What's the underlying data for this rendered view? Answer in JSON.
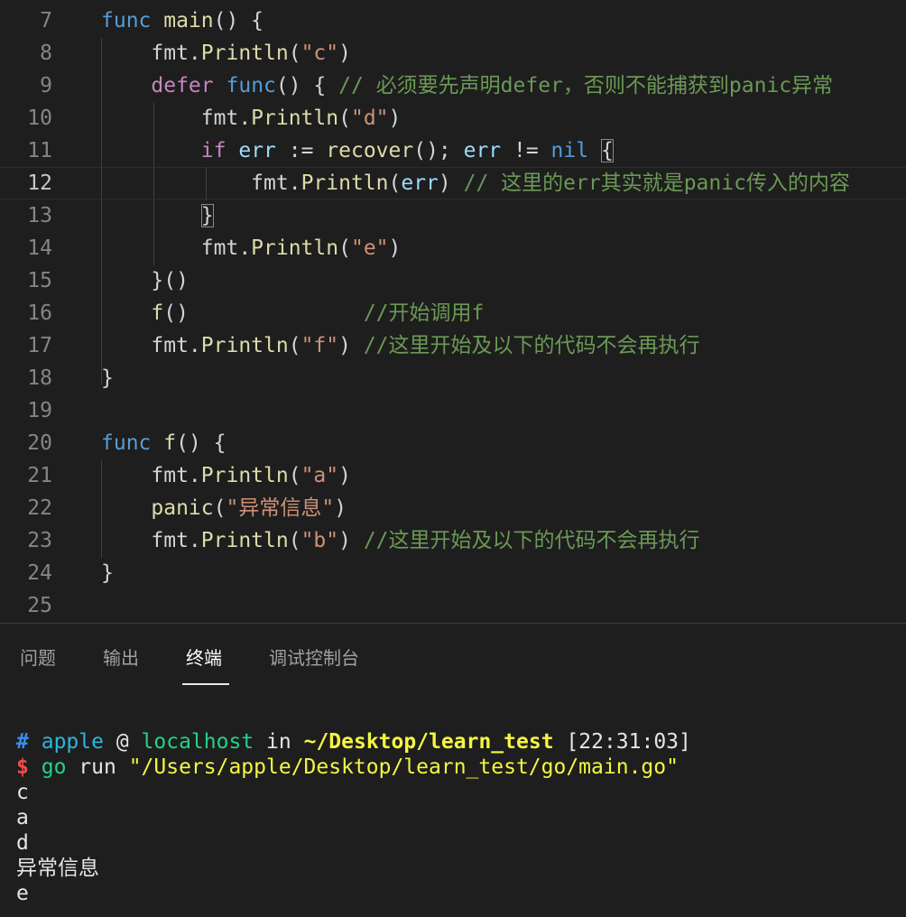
{
  "editor": {
    "lines": [
      {
        "n": "7",
        "tokens": [
          {
            "c": "kw",
            "t": "func"
          },
          {
            "c": "pl",
            "t": " "
          },
          {
            "c": "fn",
            "t": "main"
          },
          {
            "c": "pl",
            "t": "() {"
          }
        ]
      },
      {
        "n": "8",
        "tokens": [
          {
            "c": "pl",
            "t": "    fmt."
          },
          {
            "c": "fn",
            "t": "Println"
          },
          {
            "c": "pl",
            "t": "("
          },
          {
            "c": "str",
            "t": "\"c\""
          },
          {
            "c": "pl",
            "t": ")"
          }
        ]
      },
      {
        "n": "9",
        "tokens": [
          {
            "c": "pl",
            "t": "    "
          },
          {
            "c": "ctl",
            "t": "defer"
          },
          {
            "c": "pl",
            "t": " "
          },
          {
            "c": "kw",
            "t": "func"
          },
          {
            "c": "pl",
            "t": "() { "
          },
          {
            "c": "cm",
            "t": "// 必须要先声明defer，否则不能捕获到panic异常"
          }
        ]
      },
      {
        "n": "10",
        "tokens": [
          {
            "c": "pl",
            "t": "        fmt."
          },
          {
            "c": "fn",
            "t": "Println"
          },
          {
            "c": "pl",
            "t": "("
          },
          {
            "c": "str",
            "t": "\"d\""
          },
          {
            "c": "pl",
            "t": ")"
          }
        ]
      },
      {
        "n": "11",
        "tokens": [
          {
            "c": "pl",
            "t": "        "
          },
          {
            "c": "ctl",
            "t": "if"
          },
          {
            "c": "pl",
            "t": " "
          },
          {
            "c": "var",
            "t": "err"
          },
          {
            "c": "pl",
            "t": " := "
          },
          {
            "c": "fn",
            "t": "recover"
          },
          {
            "c": "pl",
            "t": "(); "
          },
          {
            "c": "var",
            "t": "err"
          },
          {
            "c": "pl",
            "t": " != "
          },
          {
            "c": "kw",
            "t": "nil"
          },
          {
            "c": "pl",
            "t": " "
          },
          {
            "c": "pl box",
            "t": "{"
          }
        ]
      },
      {
        "n": "12",
        "tokens": [
          {
            "c": "pl",
            "t": "            fmt."
          },
          {
            "c": "fn",
            "t": "Println"
          },
          {
            "c": "pl",
            "t": "("
          },
          {
            "c": "var",
            "t": "err"
          },
          {
            "c": "pl",
            "t": ") "
          },
          {
            "c": "cm",
            "t": "// 这里的err其实就是panic传入的内容"
          }
        ]
      },
      {
        "n": "13",
        "tokens": [
          {
            "c": "pl",
            "t": "        "
          },
          {
            "c": "pl box",
            "t": "}"
          }
        ]
      },
      {
        "n": "14",
        "tokens": [
          {
            "c": "pl",
            "t": "        fmt."
          },
          {
            "c": "fn",
            "t": "Println"
          },
          {
            "c": "pl",
            "t": "("
          },
          {
            "c": "str",
            "t": "\"e\""
          },
          {
            "c": "pl",
            "t": ")"
          }
        ]
      },
      {
        "n": "15",
        "tokens": [
          {
            "c": "pl",
            "t": "    }()"
          }
        ]
      },
      {
        "n": "16",
        "tokens": [
          {
            "c": "pl",
            "t": "    "
          },
          {
            "c": "fn",
            "t": "f"
          },
          {
            "c": "pl",
            "t": "()              "
          },
          {
            "c": "cm",
            "t": "//开始调用f"
          }
        ]
      },
      {
        "n": "17",
        "tokens": [
          {
            "c": "pl",
            "t": "    fmt."
          },
          {
            "c": "fn",
            "t": "Println"
          },
          {
            "c": "pl",
            "t": "("
          },
          {
            "c": "str",
            "t": "\"f\""
          },
          {
            "c": "pl",
            "t": ") "
          },
          {
            "c": "cm",
            "t": "//这里开始及以下的代码不会再执行"
          }
        ]
      },
      {
        "n": "18",
        "tokens": [
          {
            "c": "pl",
            "t": "}"
          }
        ]
      },
      {
        "n": "19",
        "tokens": []
      },
      {
        "n": "20",
        "tokens": [
          {
            "c": "kw",
            "t": "func"
          },
          {
            "c": "pl",
            "t": " "
          },
          {
            "c": "fn",
            "t": "f"
          },
          {
            "c": "pl",
            "t": "() {"
          }
        ]
      },
      {
        "n": "21",
        "tokens": [
          {
            "c": "pl",
            "t": "    fmt."
          },
          {
            "c": "fn",
            "t": "Println"
          },
          {
            "c": "pl",
            "t": "("
          },
          {
            "c": "str",
            "t": "\"a\""
          },
          {
            "c": "pl",
            "t": ")"
          }
        ]
      },
      {
        "n": "22",
        "tokens": [
          {
            "c": "pl",
            "t": "    "
          },
          {
            "c": "fn",
            "t": "panic"
          },
          {
            "c": "pl",
            "t": "("
          },
          {
            "c": "str",
            "t": "\"异常信息\""
          },
          {
            "c": "pl",
            "t": ")"
          }
        ]
      },
      {
        "n": "23",
        "tokens": [
          {
            "c": "pl",
            "t": "    fmt."
          },
          {
            "c": "fn",
            "t": "Println"
          },
          {
            "c": "pl",
            "t": "("
          },
          {
            "c": "str",
            "t": "\"b\""
          },
          {
            "c": "pl",
            "t": ") "
          },
          {
            "c": "cm",
            "t": "//这里开始及以下的代码不会再执行"
          }
        ]
      },
      {
        "n": "24",
        "tokens": [
          {
            "c": "pl",
            "t": "}"
          }
        ]
      },
      {
        "n": "25",
        "tokens": []
      }
    ],
    "current_line": "12"
  },
  "panel": {
    "tabs": [
      {
        "label": "问题"
      },
      {
        "label": "输出"
      },
      {
        "label": "终端",
        "active": true
      },
      {
        "label": "调试控制台"
      }
    ]
  },
  "terminal": {
    "prompt": {
      "hash": "#",
      "user": "apple",
      "at": "@",
      "host": "localhost",
      "in": "in",
      "path": "~/Desktop/learn_test",
      "time": "[22:31:03]"
    },
    "command": {
      "dollar": "$",
      "go": "go",
      "run": "run",
      "file": "\"/Users/apple/Desktop/learn_test/go/main.go\""
    },
    "output": [
      "c",
      "a",
      "d",
      "异常信息",
      "e"
    ]
  }
}
